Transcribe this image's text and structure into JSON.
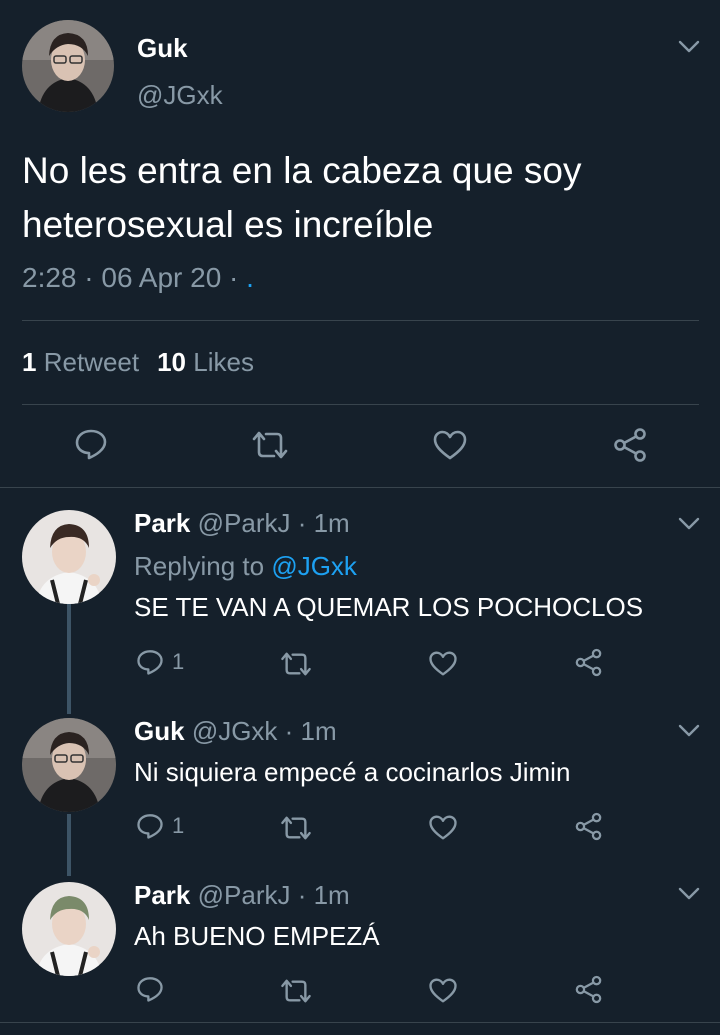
{
  "main_tweet": {
    "display_name": "Guk",
    "handle": "@JGxk",
    "text": "No les entra en la cabeza que soy heterosexual es increíble",
    "time": "2:28",
    "sep1": " · ",
    "date": "06 Apr 20",
    "sep2": " · ",
    "source_dot": ".",
    "retweets_count": "1",
    "retweets_label": "Retweet",
    "likes_count": "10",
    "likes_label": "Likes"
  },
  "replies": [
    {
      "display_name": "Park",
      "handle": "@ParkJ",
      "time": "1m",
      "replying_prefix": "Replying to ",
      "replying_to": "@JGxk",
      "text": "SE TE VAN A QUEMAR LOS POCHOCLOS",
      "reply_count": "1"
    },
    {
      "display_name": "Guk",
      "handle": "@JGxk",
      "time": "1m",
      "text": "Ni siquiera empecé a cocinarlos Jimin",
      "reply_count": "1"
    },
    {
      "display_name": "Park",
      "handle": "@ParkJ",
      "time": "1m",
      "text": "Ah BUENO EMPEZÁ",
      "reply_count": ""
    }
  ],
  "icons": {
    "reply": "reply-bubble-icon",
    "retweet": "retweet-icon",
    "like": "heart-icon",
    "share": "share-icon",
    "menu": "chevron-down-icon"
  },
  "colors": {
    "background": "#15202b",
    "secondary_text": "#8899a6",
    "accent": "#1da1f2",
    "divider": "#38444d"
  }
}
